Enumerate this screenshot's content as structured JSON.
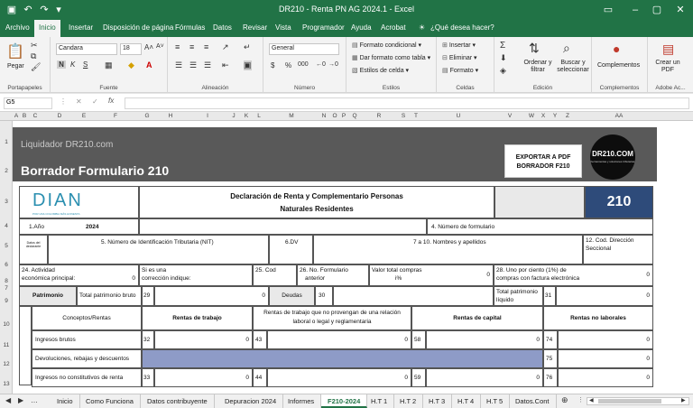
{
  "title": "DR210 - Renta PN AG 2024.1  -  Excel",
  "ribbon_tabs": [
    "Archivo",
    "Inicio",
    "Insertar",
    "Disposición de página",
    "Fórmulas",
    "Datos",
    "Revisar",
    "Vista",
    "Programador",
    "Ayuda",
    "Acrobat",
    "¿Qué desea hacer?"
  ],
  "clipboard": {
    "paste": "Pegar",
    "label": "Portapapeles"
  },
  "font": {
    "name": "Candara",
    "size": "18",
    "label": "Fuente",
    "bold": "N",
    "italic": "K",
    "underline": "S"
  },
  "alignment": {
    "label": "Alineación"
  },
  "number": {
    "format": "General",
    "label": "Número",
    "currency": "$",
    "percent": "%",
    "thousands": "000"
  },
  "styles": {
    "conditional": "Formato condicional",
    "table": "Dar formato como tabla",
    "cell_styles": "Estilos de celda",
    "label": "Estilos"
  },
  "cells": {
    "insert": "Insertar",
    "delete": "Eliminar",
    "format": "Formato",
    "label": "Celdas"
  },
  "editing": {
    "sort": "Ordenar y filtrar",
    "find": "Buscar y seleccionar",
    "label": "Edición"
  },
  "complements": {
    "btn": "Complementos",
    "label": "Complementos"
  },
  "adobe": {
    "btn": "Crear un PDF",
    "label": "Adobe Ac..."
  },
  "formula_bar": {
    "cell_ref": "G5",
    "fx": "fx"
  },
  "columns": [
    "A",
    "B",
    "C",
    "D",
    "E",
    "F",
    "G",
    "H",
    "I",
    "J",
    "K",
    "L",
    "M",
    "N",
    "O",
    "P",
    "Q",
    "R",
    "S",
    "T",
    "U",
    "V",
    "W",
    "X",
    "Y",
    "Z",
    "AA"
  ],
  "rows": [
    "1",
    "2",
    "3",
    "4",
    "5",
    "6",
    "7",
    "8",
    "9",
    "10",
    "11",
    "12",
    "13"
  ],
  "banner": {
    "subtitle": "Liquidador DR210.com",
    "title": "Borrador Formulario 210",
    "export_btn_line1": "EXPORTAR A PDF",
    "export_btn_line2": "BORRADOR F210",
    "logo_text": "DR210.COM",
    "logo_sub": "herramientas y soluciones tributarias"
  },
  "form": {
    "dian": "DIAN",
    "dian_sub": "POR UNA COLOMBIA MÁS HONESTA",
    "heading_1": "Declaración de Renta y Complementario Personas",
    "heading_2": "Naturales Residentes",
    "form_number": "210",
    "year_label": "1.Año",
    "year_value": "2024",
    "form_number_label": "4. Número de formulario",
    "side_label": "Datos del declarante",
    "nit_label": "5. Número de Identificación Tributaria (NIT)",
    "dv_label": "6.DV",
    "names_label": "7 a 10. Nombres y apellidos",
    "seccional_label_1": "12. Cod. Dirección",
    "seccional_label_2": "Seccional",
    "activity_label_1": "24. Actividad",
    "activity_label_2": "económica principal:",
    "activity_value": "0",
    "correction_label_1": "Si es una",
    "correction_label_2": "corrección indique:",
    "cod_label": "25. Cod",
    "prev_form_label_1": "26. No. Formulario",
    "prev_form_label_2": "anterior",
    "total_value_label_1": "Valor total compras",
    "total_value_label_2": "i%",
    "total_value_value": "0",
    "uno_label_1": "28. Uno por ciento (1%) de",
    "uno_label_2": "compras con factura electrónica",
    "uno_value": "0",
    "patrimonio": "Patrimonio",
    "patrimonio_bruto": "Total patrimonio bruto",
    "patrimonio_bruto_num": "29",
    "patrimonio_bruto_value": "0",
    "deudas": "Deudas",
    "deudas_num": "30",
    "patrimonio_liquido_1": "Total patrimonio",
    "patrimonio_liquido_2": "líquido",
    "patrimonio_liquido_num": "31",
    "patrimonio_liquido_value": "0",
    "conceptos": "Conceptos/Rentas",
    "col_trabajo": "Rentas de trabajo",
    "col_no_relacion_1": "Rentas de trabajo que no provengan de una relación",
    "col_no_relacion_2": "laboral o legal y reglamentaria",
    "col_capital": "Rentas de capital",
    "col_no_laborales": "Rentas no laborales",
    "rows": [
      {
        "label": "Ingresos brutos",
        "n1": "32",
        "v1": "0",
        "n2": "43",
        "v2": "0",
        "n3": "58",
        "v3": "0",
        "n4": "74",
        "v4": "0"
      },
      {
        "label": "Devoluciones, rebajas y descuentos",
        "n1": "",
        "v1": "",
        "n2": "",
        "v2": "",
        "n3": "",
        "v3": "",
        "n4": "75",
        "v4": "0"
      },
      {
        "label": "Ingresos no constitutivos de renta",
        "n1": "33",
        "v1": "0",
        "n2": "44",
        "v2": "0",
        "n3": "59",
        "v3": "0",
        "n4": "76",
        "v4": "0"
      }
    ]
  },
  "sheet_tabs": [
    "Inicio",
    "Como Funciona",
    "Datos contribuyente",
    "Depuracion 2024",
    "Informes",
    "F210-2024",
    "H.T 1",
    "H.T 2",
    "H.T 3",
    "H.T 4",
    "H.T 5",
    "Datos.Cont"
  ],
  "active_sheet": "F210-2024",
  "colors": {
    "excel_green": "#217346",
    "banner": "#595959",
    "form_dark": "#2e4b7a",
    "gray_fill": "#8e9bc7"
  }
}
